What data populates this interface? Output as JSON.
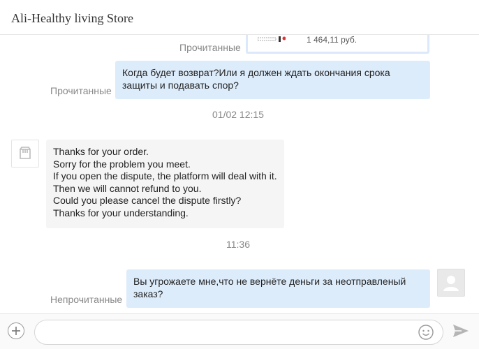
{
  "header": {
    "title": "Ali-Healthy living Store"
  },
  "chat": {
    "product_card": {
      "price_fragment": "1 464,11 руб."
    },
    "status_read_1": "Прочитанные",
    "status_read_2": "Прочитанные",
    "message_1": {
      "lines": [
        "Когда будет возврат?Или я должен ждать окончания срока",
        "защиты и подавать спор?"
      ]
    },
    "timestamp_1": "01/02 12:15",
    "message_2": {
      "lines": [
        "Thanks for your order.",
        "Sorry for the problem you meet.",
        "If you open the dispute, the platform will deal with it.",
        "Then we will cannot refund to you.",
        "Could you please cancel the dispute firstly?",
        "Thanks for your understanding."
      ]
    },
    "timestamp_2": "11:36",
    "status_unread": "Непрочитанные",
    "message_3": {
      "lines": [
        "Вы угрожаете мне,что не вернёте деньги за неотправленый",
        "заказ?"
      ]
    }
  },
  "composer": {
    "placeholder": ""
  },
  "icons": {
    "add": "plus-circle-icon",
    "emoji": "smiley-icon",
    "send": "paper-plane-icon",
    "store_avatar": "store-icon",
    "user_avatar": "user-icon"
  },
  "colors": {
    "sent_bubble": "#ddecfb",
    "received_bubble": "#f5f5f5",
    "status_text": "#888888"
  }
}
